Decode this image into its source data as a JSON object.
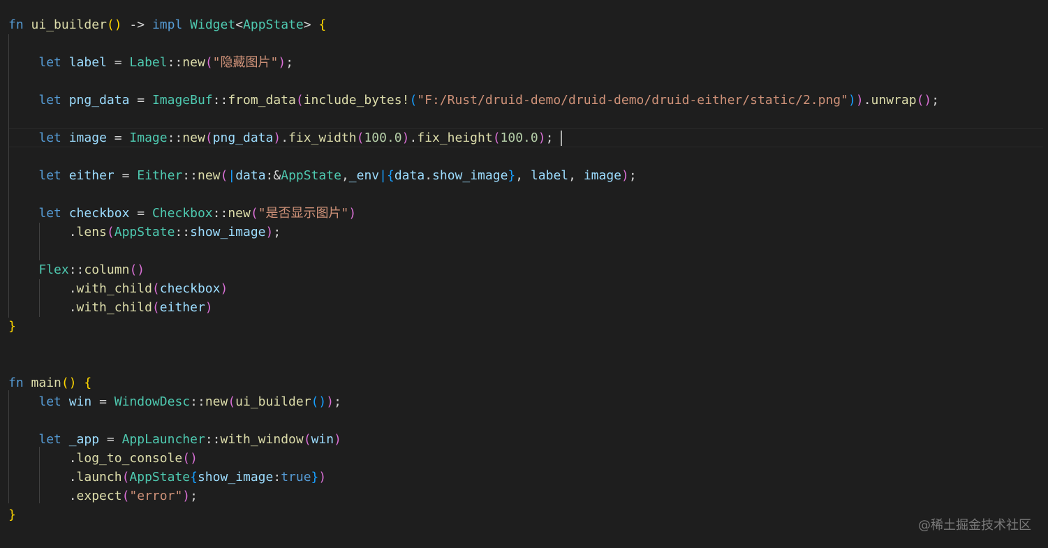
{
  "theme": {
    "background": "#1e1e1e",
    "keyword": "#569cd6",
    "function": "#dcdcaa",
    "type": "#4ec9b0",
    "variable": "#9cdcfe",
    "string": "#ce9178",
    "number": "#b5cea8",
    "bracket_level_1": "#ffd700",
    "bracket_level_2": "#da70d6",
    "bracket_level_3": "#179fff"
  },
  "code_lines": [
    [
      [
        "kw",
        "fn"
      ],
      [
        "op",
        " "
      ],
      [
        "fn",
        "ui_builder"
      ],
      [
        "b1",
        "()"
      ],
      [
        "op",
        " -> "
      ],
      [
        "kw",
        "impl"
      ],
      [
        "op",
        " "
      ],
      [
        "ty",
        "Widget"
      ],
      [
        "op",
        "<"
      ],
      [
        "ty",
        "AppState"
      ],
      [
        "op",
        "> "
      ],
      [
        "b1",
        "{"
      ]
    ],
    [],
    [
      [
        "op",
        "    "
      ],
      [
        "kw",
        "let"
      ],
      [
        "op",
        " "
      ],
      [
        "var",
        "label"
      ],
      [
        "op",
        " = "
      ],
      [
        "ty",
        "Label"
      ],
      [
        "op",
        "::"
      ],
      [
        "fn",
        "new"
      ],
      [
        "b2",
        "("
      ],
      [
        "str",
        "\"隐藏图片\""
      ],
      [
        "b2",
        ")"
      ],
      [
        "op",
        ";"
      ]
    ],
    [],
    [
      [
        "op",
        "    "
      ],
      [
        "kw",
        "let"
      ],
      [
        "op",
        " "
      ],
      [
        "var",
        "png_data"
      ],
      [
        "op",
        " = "
      ],
      [
        "ty",
        "ImageBuf"
      ],
      [
        "op",
        "::"
      ],
      [
        "fn",
        "from_data"
      ],
      [
        "b2",
        "("
      ],
      [
        "fn",
        "include_bytes!"
      ],
      [
        "b3",
        "("
      ],
      [
        "str",
        "\"F:/Rust/druid-demo/druid-demo/druid-either/static/2.png\""
      ],
      [
        "b3",
        ")"
      ],
      [
        "b2",
        ")"
      ],
      [
        "op",
        "."
      ],
      [
        "fn",
        "unwrap"
      ],
      [
        "b2",
        "()"
      ],
      [
        "op",
        ";"
      ]
    ],
    [],
    [
      [
        "op",
        "    "
      ],
      [
        "kw",
        "let"
      ],
      [
        "op",
        " "
      ],
      [
        "var",
        "image"
      ],
      [
        "op",
        " = "
      ],
      [
        "ty",
        "Image"
      ],
      [
        "op",
        "::"
      ],
      [
        "fn",
        "new"
      ],
      [
        "b2",
        "("
      ],
      [
        "var",
        "png_data"
      ],
      [
        "b2",
        ")"
      ],
      [
        "op",
        "."
      ],
      [
        "fn",
        "fix_width"
      ],
      [
        "b2",
        "("
      ],
      [
        "num",
        "100.0"
      ],
      [
        "b2",
        ")"
      ],
      [
        "op",
        "."
      ],
      [
        "fn",
        "fix_height"
      ],
      [
        "b2",
        "("
      ],
      [
        "num",
        "100.0"
      ],
      [
        "b2",
        ")"
      ],
      [
        "op",
        ";"
      ]
    ],
    [],
    [
      [
        "op",
        "    "
      ],
      [
        "kw",
        "let"
      ],
      [
        "op",
        " "
      ],
      [
        "var",
        "either"
      ],
      [
        "op",
        " = "
      ],
      [
        "ty",
        "Either"
      ],
      [
        "op",
        "::"
      ],
      [
        "fn",
        "new"
      ],
      [
        "b2",
        "("
      ],
      [
        "b3",
        "|"
      ],
      [
        "var",
        "data"
      ],
      [
        "op",
        ":&"
      ],
      [
        "ty",
        "AppState"
      ],
      [
        "op",
        ","
      ],
      [
        "var",
        "_env"
      ],
      [
        "b3",
        "|"
      ],
      [
        "b3",
        "{"
      ],
      [
        "var",
        "data"
      ],
      [
        "op",
        "."
      ],
      [
        "var",
        "show_image"
      ],
      [
        "b3",
        "}"
      ],
      [
        "op",
        ", "
      ],
      [
        "var",
        "label"
      ],
      [
        "op",
        ", "
      ],
      [
        "var",
        "image"
      ],
      [
        "b2",
        ")"
      ],
      [
        "op",
        ";"
      ]
    ],
    [],
    [
      [
        "op",
        "    "
      ],
      [
        "kw",
        "let"
      ],
      [
        "op",
        " "
      ],
      [
        "var",
        "checkbox"
      ],
      [
        "op",
        " = "
      ],
      [
        "ty",
        "Checkbox"
      ],
      [
        "op",
        "::"
      ],
      [
        "fn",
        "new"
      ],
      [
        "b2",
        "("
      ],
      [
        "str",
        "\"是否显示图片\""
      ],
      [
        "b2",
        ")"
      ]
    ],
    [
      [
        "op",
        "        ."
      ],
      [
        "fn",
        "lens"
      ],
      [
        "b2",
        "("
      ],
      [
        "ty",
        "AppState"
      ],
      [
        "op",
        "::"
      ],
      [
        "var",
        "show_image"
      ],
      [
        "b2",
        ")"
      ],
      [
        "op",
        ";"
      ]
    ],
    [],
    [
      [
        "op",
        "    "
      ],
      [
        "ty",
        "Flex"
      ],
      [
        "op",
        "::"
      ],
      [
        "fn",
        "column"
      ],
      [
        "b2",
        "()"
      ]
    ],
    [
      [
        "op",
        "        ."
      ],
      [
        "fn",
        "with_child"
      ],
      [
        "b2",
        "("
      ],
      [
        "var",
        "checkbox"
      ],
      [
        "b2",
        ")"
      ]
    ],
    [
      [
        "op",
        "        ."
      ],
      [
        "fn",
        "with_child"
      ],
      [
        "b2",
        "("
      ],
      [
        "var",
        "either"
      ],
      [
        "b2",
        ")"
      ]
    ],
    [
      [
        "b1",
        "}"
      ]
    ],
    [],
    [],
    [
      [
        "kw",
        "fn"
      ],
      [
        "op",
        " "
      ],
      [
        "fn",
        "main"
      ],
      [
        "b1",
        "()"
      ],
      [
        "op",
        " "
      ],
      [
        "b1",
        "{"
      ]
    ],
    [
      [
        "op",
        "    "
      ],
      [
        "kw",
        "let"
      ],
      [
        "op",
        " "
      ],
      [
        "var",
        "win"
      ],
      [
        "op",
        " = "
      ],
      [
        "ty",
        "WindowDesc"
      ],
      [
        "op",
        "::"
      ],
      [
        "fn",
        "new"
      ],
      [
        "b2",
        "("
      ],
      [
        "fn",
        "ui_builder"
      ],
      [
        "b3",
        "()"
      ],
      [
        "b2",
        ")"
      ],
      [
        "op",
        ";"
      ]
    ],
    [],
    [
      [
        "op",
        "    "
      ],
      [
        "kw",
        "let"
      ],
      [
        "op",
        " "
      ],
      [
        "var",
        "_app"
      ],
      [
        "op",
        " = "
      ],
      [
        "ty",
        "AppLauncher"
      ],
      [
        "op",
        "::"
      ],
      [
        "fn",
        "with_window"
      ],
      [
        "b2",
        "("
      ],
      [
        "var",
        "win"
      ],
      [
        "b2",
        ")"
      ]
    ],
    [
      [
        "op",
        "        ."
      ],
      [
        "fn",
        "log_to_console"
      ],
      [
        "b2",
        "()"
      ]
    ],
    [
      [
        "op",
        "        ."
      ],
      [
        "fn",
        "launch"
      ],
      [
        "b2",
        "("
      ],
      [
        "ty",
        "AppState"
      ],
      [
        "b3",
        "{"
      ],
      [
        "var",
        "show_image"
      ],
      [
        "op",
        ":"
      ],
      [
        "kw",
        "true"
      ],
      [
        "b3",
        "}"
      ],
      [
        "b2",
        ")"
      ]
    ],
    [
      [
        "op",
        "        ."
      ],
      [
        "fn",
        "expect"
      ],
      [
        "b2",
        "("
      ],
      [
        "str",
        "\"error\""
      ],
      [
        "b2",
        ")"
      ],
      [
        "op",
        ";"
      ]
    ],
    [
      [
        "b1",
        "}"
      ]
    ]
  ],
  "watermark": "@稀土掘金技术社区"
}
